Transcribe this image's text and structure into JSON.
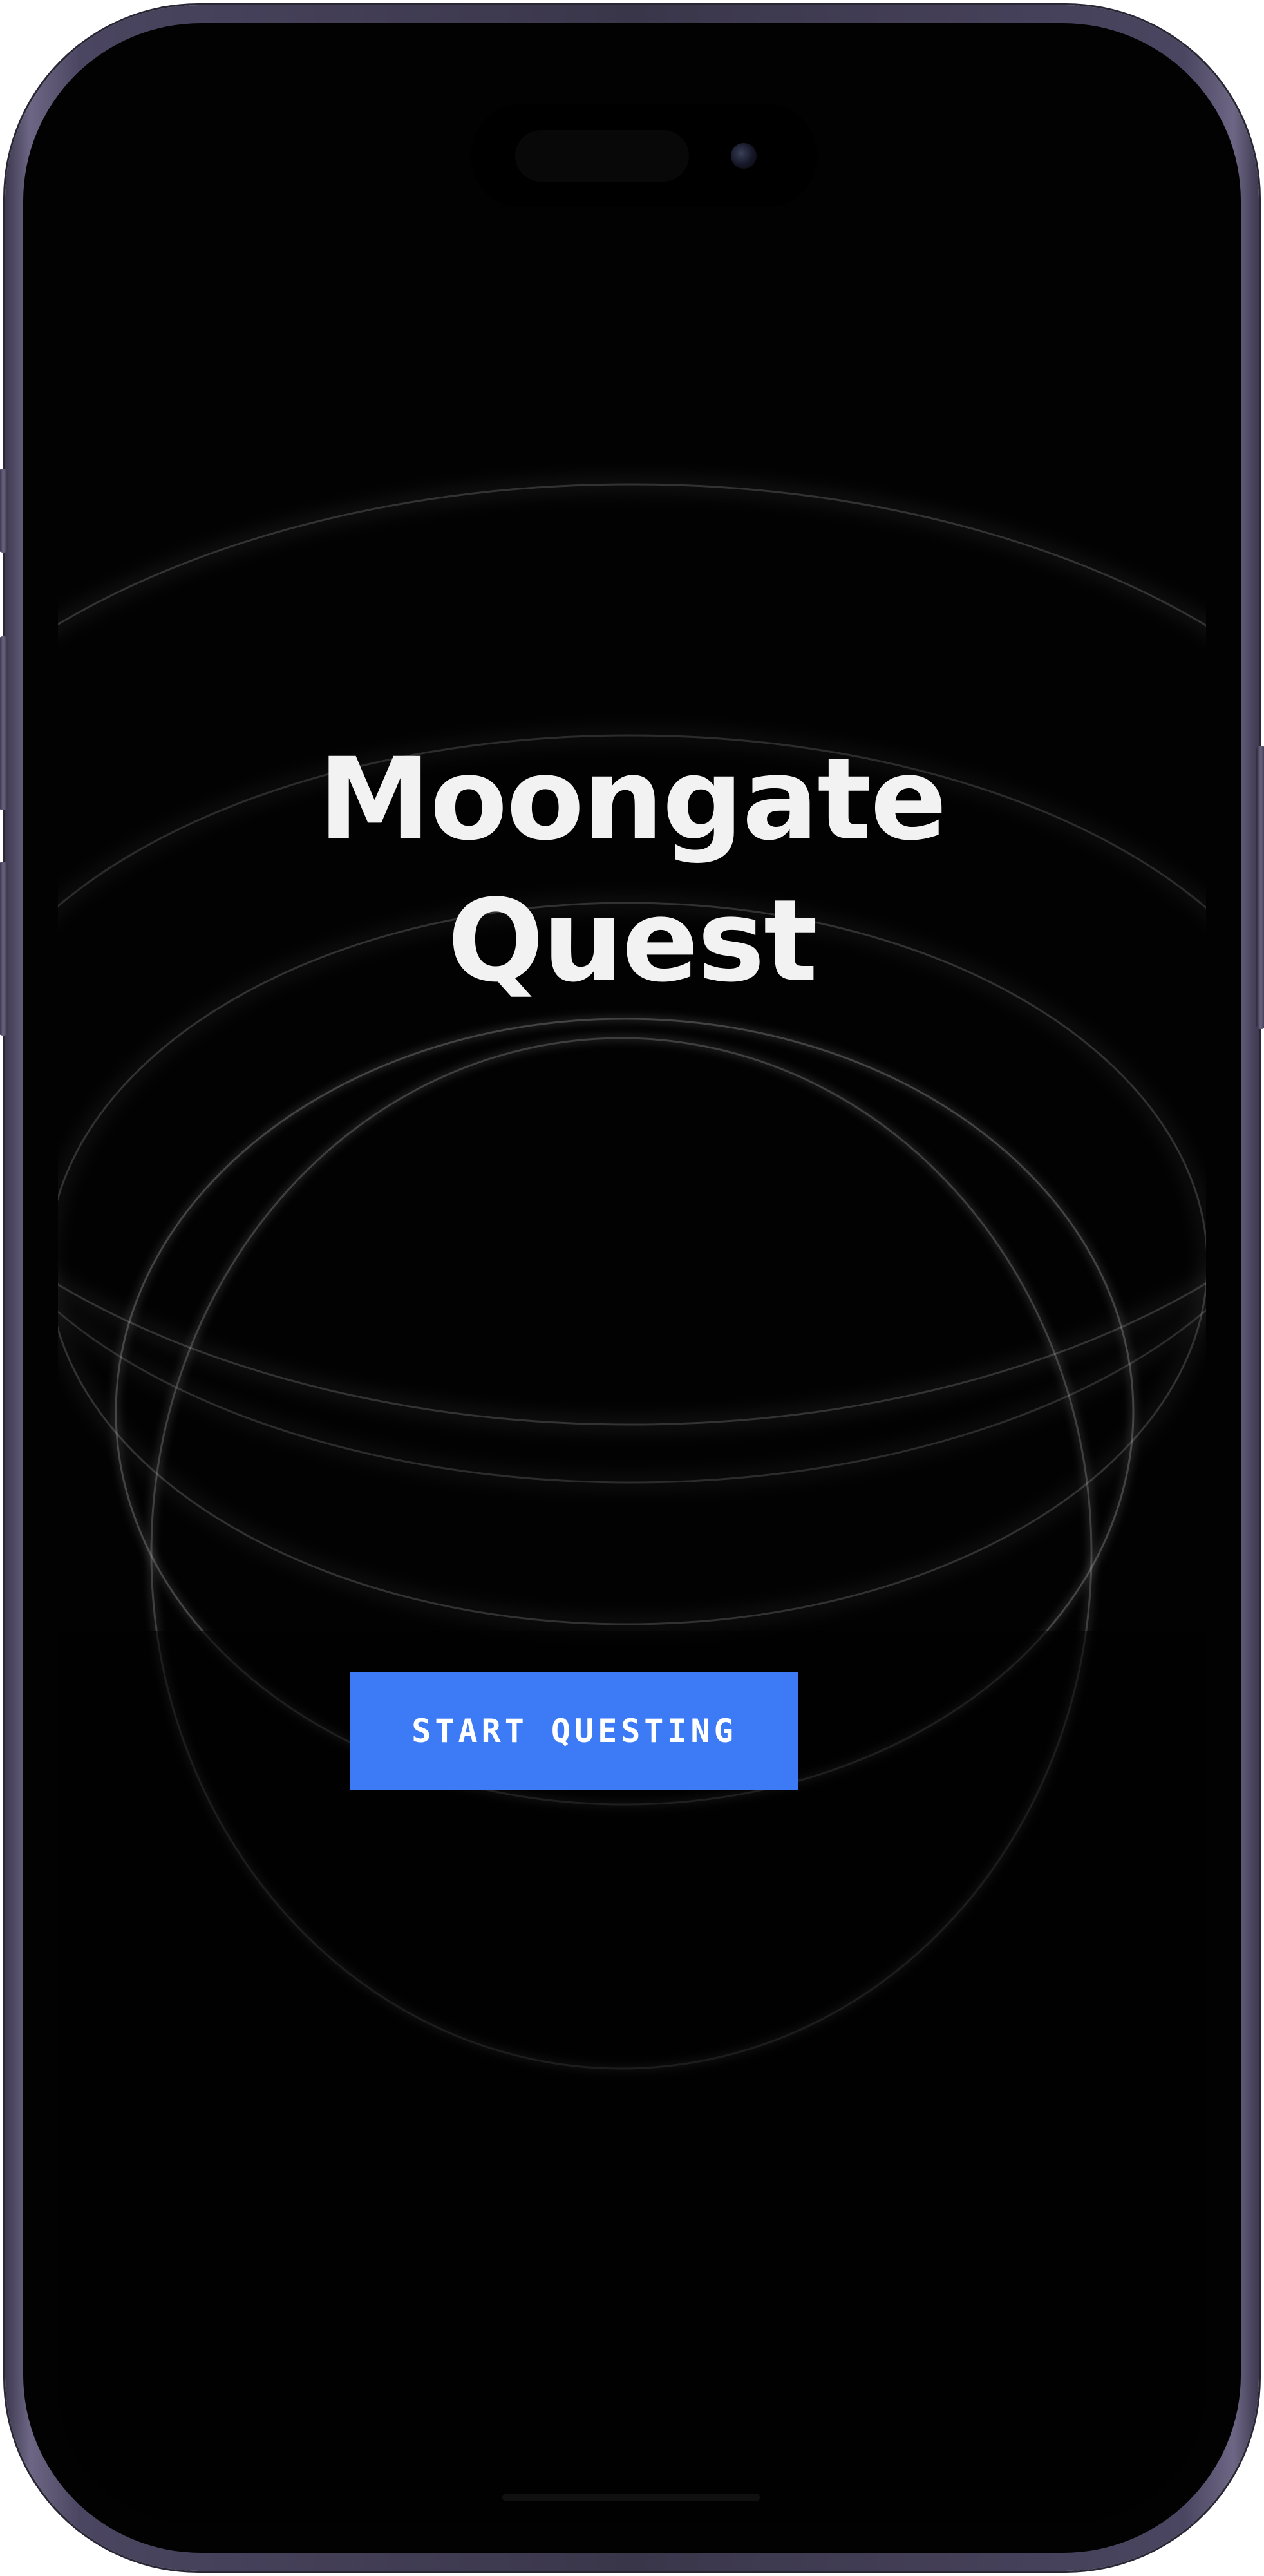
{
  "app": {
    "title_line1": "Moongate",
    "title_line2": "Quest"
  },
  "actions": {
    "start_label": "START QUESTING"
  },
  "colors": {
    "background": "#020202",
    "title_text": "#f2f2f2",
    "button_bg": "#3d7bf6",
    "button_text": "#ffffff",
    "device_frame": "#4a4560"
  }
}
